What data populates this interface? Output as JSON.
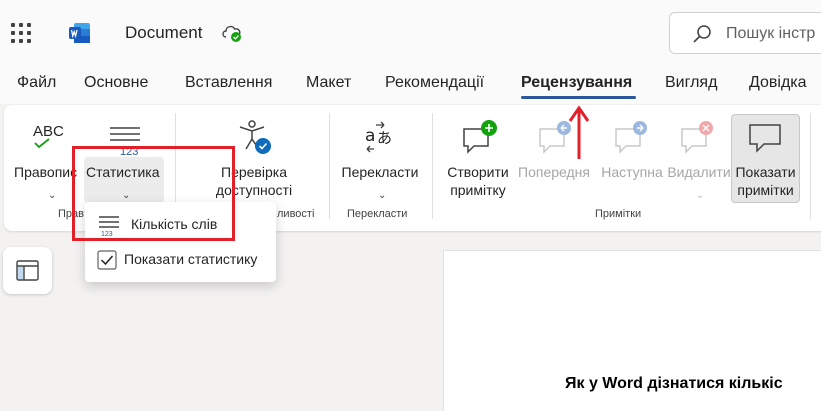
{
  "titlebar": {
    "doc_title": "Document",
    "search_placeholder": "Пошук інстр"
  },
  "tabs": [
    {
      "label": "Файл"
    },
    {
      "label": "Основне"
    },
    {
      "label": "Вставлення"
    },
    {
      "label": "Макет"
    },
    {
      "label": "Рекомендації"
    },
    {
      "label": "Рецензування"
    },
    {
      "label": "Вигляд"
    },
    {
      "label": "Довідка"
    }
  ],
  "active_tab": "Рецензування",
  "ribbon": {
    "spelling": {
      "label": "Правопис",
      "icon_text": "ABC"
    },
    "statistics": {
      "label": "Статистика",
      "icon_text": "123"
    },
    "accessibility": {
      "line1": "Перевірка",
      "line2": "доступності"
    },
    "translate": {
      "label": "Перекласти"
    },
    "new_comment": {
      "line1": "Створити",
      "line2": "примітку"
    },
    "previous": {
      "label": "Попередня"
    },
    "next": {
      "label": "Наступна"
    },
    "delete": {
      "label": "Видалити"
    },
    "show_comments": {
      "line1": "Показати",
      "line2": "примітки"
    },
    "groups": {
      "proofing_partial": "Прав",
      "accessibility_partial": "ливості",
      "language": "Перекласти",
      "comments": "Примітки"
    }
  },
  "dropdown": {
    "word_count": "Кількість слів",
    "show_stats": "Показати статистику"
  },
  "document": {
    "heading": "Як у Word дізнатися кількіс"
  },
  "colors": {
    "accent": "#2b579a",
    "word_blue": "#185abd",
    "annotation_red": "#e1202a",
    "success_green": "#13a10e"
  }
}
